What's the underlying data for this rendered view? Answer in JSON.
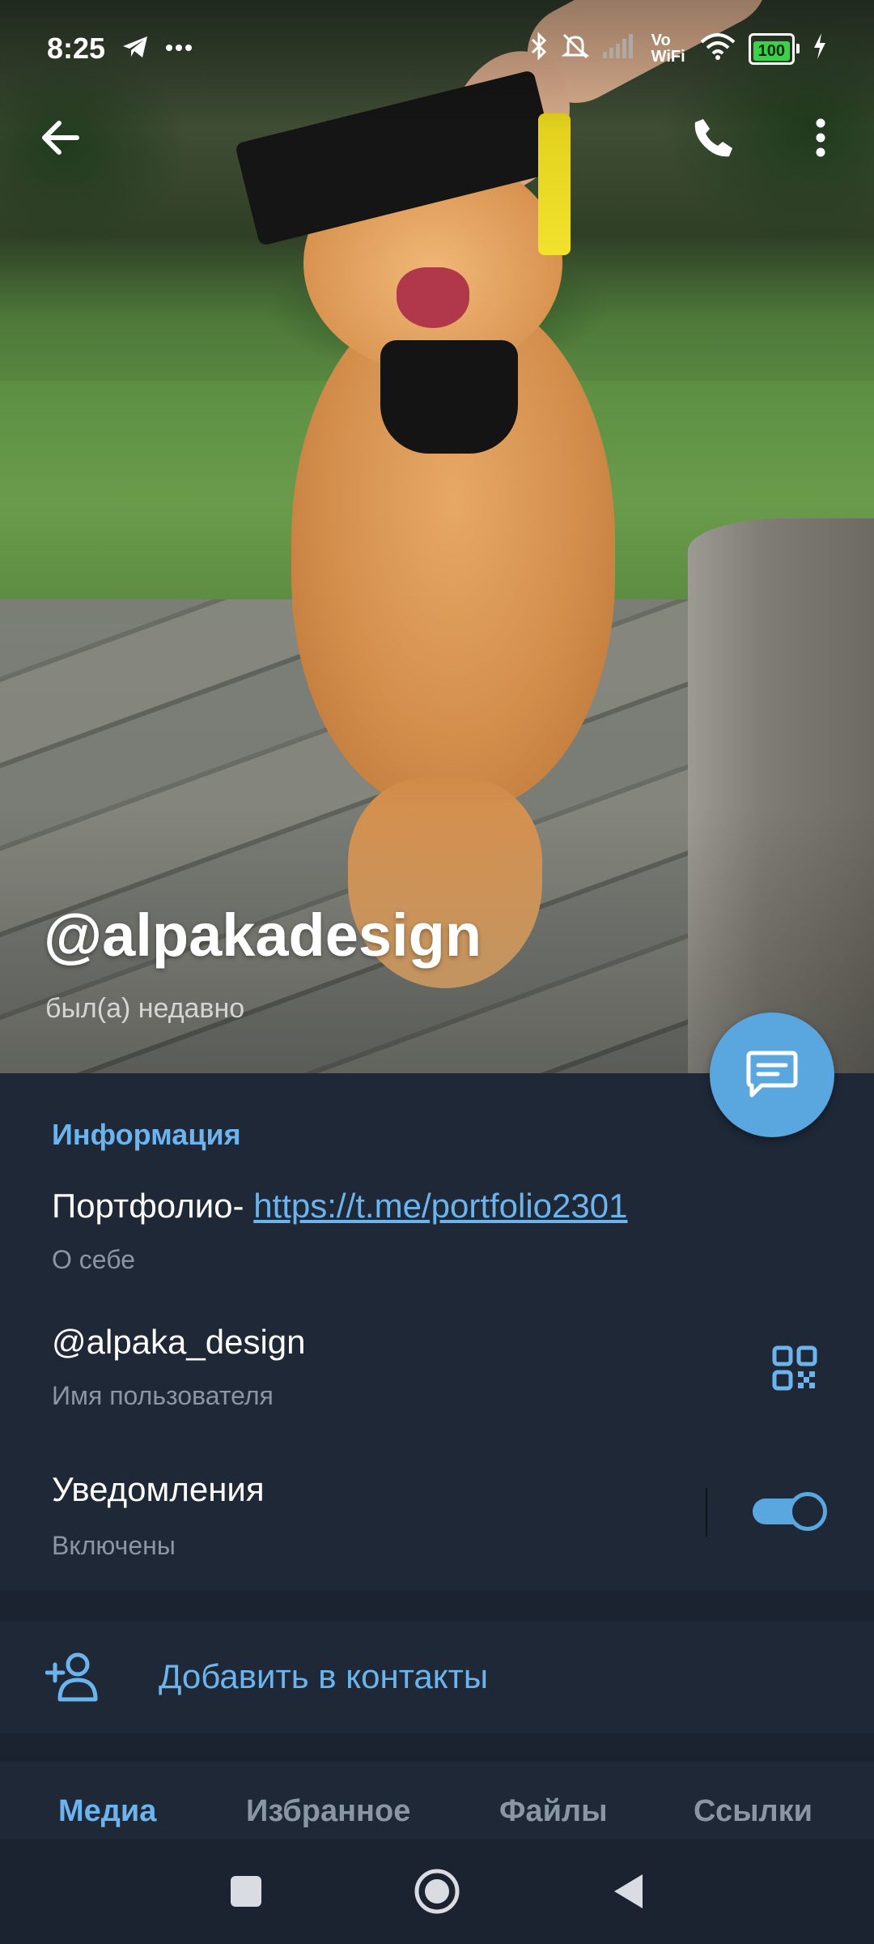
{
  "status_bar": {
    "time": "8:25",
    "battery": "100",
    "network": "Vo WiFi",
    "icons": [
      "telegram-icon",
      "more-dots-icon",
      "bluetooth-icon",
      "mute-icon",
      "signal-icon",
      "wifi-icon",
      "battery-icon",
      "charging-icon"
    ]
  },
  "toolbar": {
    "back_icon": "back-arrow-icon",
    "call_icon": "phone-icon",
    "menu_icon": "more-vertical-icon"
  },
  "profile": {
    "name": "@alpakadesign",
    "status": "был(а) недавно"
  },
  "info": {
    "title": "Информация",
    "bio_prefix": "Портфолио- ",
    "bio_link": "https://t.me/portfolio2301",
    "bio_label": "О себе",
    "username": "@alpaka_design",
    "username_label": "Имя пользователя",
    "notifications": "Уведомления",
    "notifications_status": "Включены",
    "notifications_enabled": true
  },
  "add_contact": {
    "label": "Добавить в контакты"
  },
  "tabs": [
    {
      "label": "Медиа",
      "active": true
    },
    {
      "label": "Избранное",
      "active": false
    },
    {
      "label": "Файлы",
      "active": false
    },
    {
      "label": "Ссылки",
      "active": false
    }
  ],
  "colors": {
    "accent": "#6cb4ee",
    "fab": "#5aa6df",
    "panel": "#1f2837",
    "background": "#1c2330"
  }
}
